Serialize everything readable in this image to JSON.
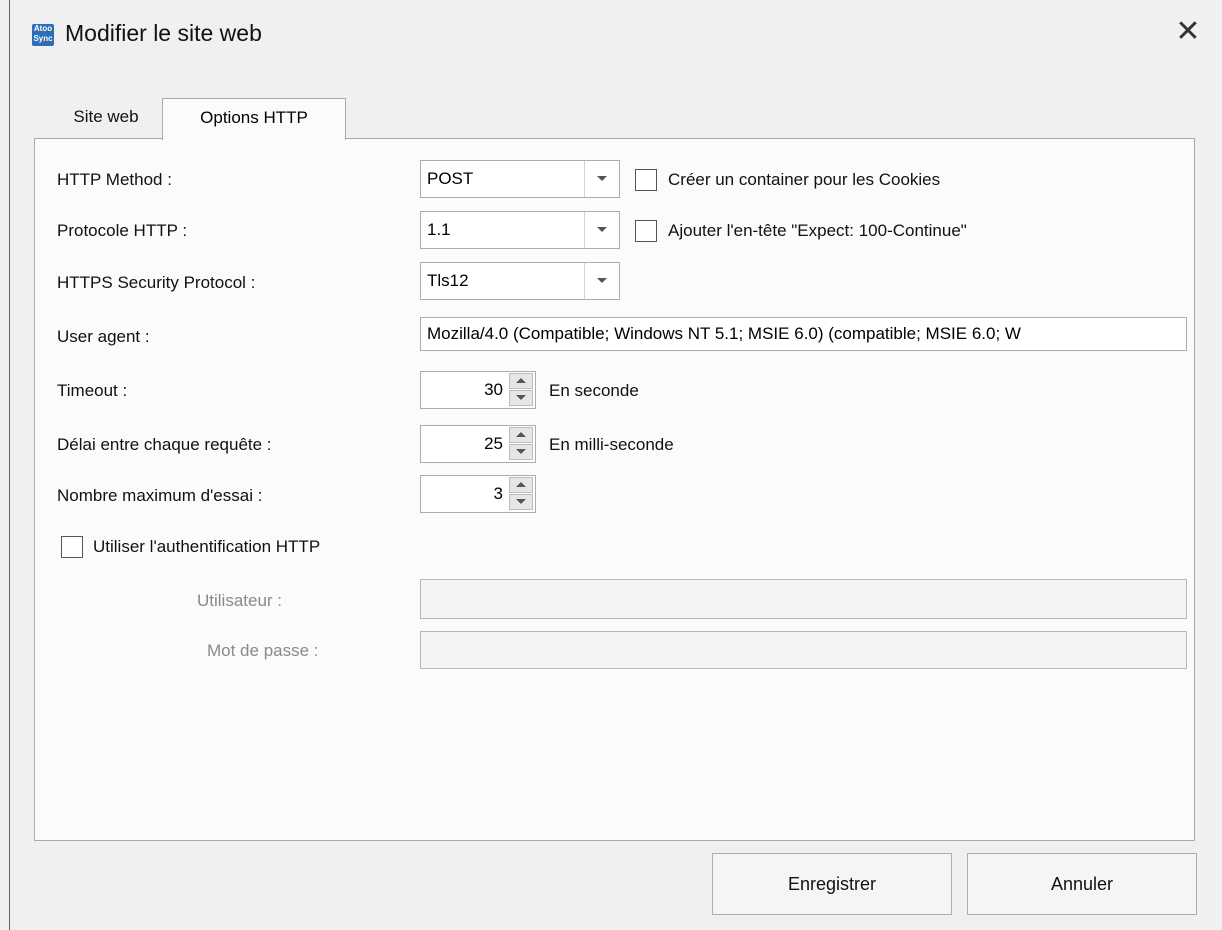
{
  "window": {
    "title": "Modifier le site web",
    "app_icon_lines": [
      "Atoo",
      "Sync"
    ]
  },
  "tabs": [
    {
      "label": "Site web",
      "active": false
    },
    {
      "label": "Options HTTP",
      "active": true
    }
  ],
  "form": {
    "http_method": {
      "label": "HTTP Method :",
      "value": "POST"
    },
    "cookies_checkbox": {
      "label": "Créer un container pour les Cookies",
      "checked": false
    },
    "http_protocol": {
      "label": "Protocole HTTP :",
      "value": "1.1"
    },
    "expect_checkbox": {
      "label": "Ajouter l'en-tête \"Expect: 100-Continue\"",
      "checked": false
    },
    "https_protocol": {
      "label": "HTTPS Security Protocol :",
      "value": "Tls12"
    },
    "user_agent": {
      "label": "User agent :",
      "value": "Mozilla/4.0 (Compatible; Windows NT 5.1; MSIE 6.0) (compatible; MSIE 6.0; W"
    },
    "timeout": {
      "label": "Timeout :",
      "value": "30",
      "unit": "En seconde"
    },
    "delay": {
      "label": "Délai entre chaque requête :",
      "value": "25",
      "unit": "En milli-seconde"
    },
    "max_tries": {
      "label": "Nombre maximum d'essai :",
      "value": "3"
    },
    "auth_checkbox": {
      "label": "Utiliser l'authentification HTTP",
      "checked": false
    },
    "user": {
      "label": "Utilisateur :",
      "value": ""
    },
    "password": {
      "label": "Mot de passe :",
      "value": ""
    }
  },
  "buttons": {
    "save": "Enregistrer",
    "cancel": "Annuler"
  },
  "icons": {
    "close": "close-icon",
    "dropdown": "chevron-down-icon",
    "spin_up": "spin-up-icon",
    "spin_down": "spin-down-icon"
  },
  "colors": {
    "accent": "#3a6fb0",
    "window_bg": "#f0f0f0"
  }
}
